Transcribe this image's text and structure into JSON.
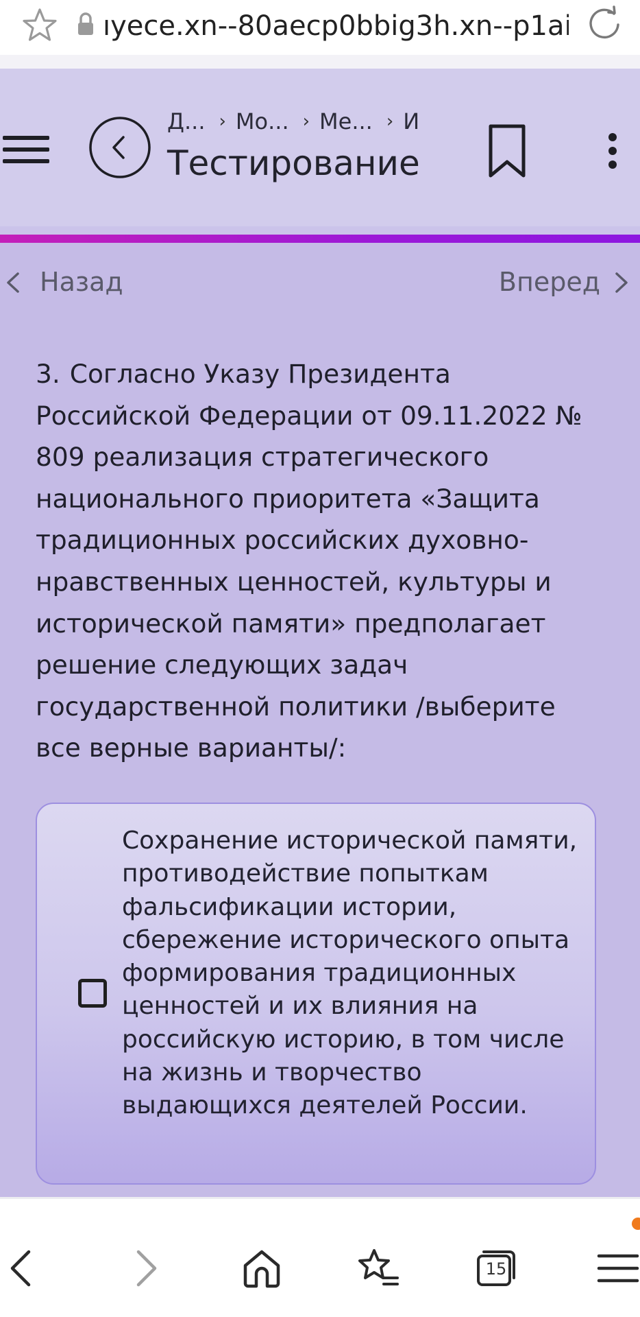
{
  "browser": {
    "url": "ıyece.xn--80aecp0bbig3h.xn--p1ai",
    "tabs_count": "15",
    "notification_color": "#f07a1c"
  },
  "header": {
    "breadcrumbs": [
      "Д...",
      "Мо...",
      "Ме...",
      "И"
    ],
    "title": "Тестирование"
  },
  "nav": {
    "back_label": "Назад",
    "forward_label": "Вперед"
  },
  "question": {
    "number": "3.",
    "text": "Согласно Указу Президента Российской Федерации от 09.11.2022 № 809 реализация стратегического национального приоритета «Защита традиционных российских духовно-нравственных ценностей, культуры и исторической памяти» предполагает решение следующих задач государственной политики /выберите все верные варианты/:"
  },
  "options": [
    {
      "text": "Сохранение исторической памяти, противодействие попыткам фальсификации истории, сбережение исторического опыта формирования традиционных ценностей и их влияния на российскую историю, в том числе на жизнь и творчество выдающихся деятелей России.",
      "checked": false
    }
  ],
  "colors": {
    "page_bg": "#c5bbe6",
    "header_bg": "#d2ccec",
    "accent": "#9b18d8"
  }
}
